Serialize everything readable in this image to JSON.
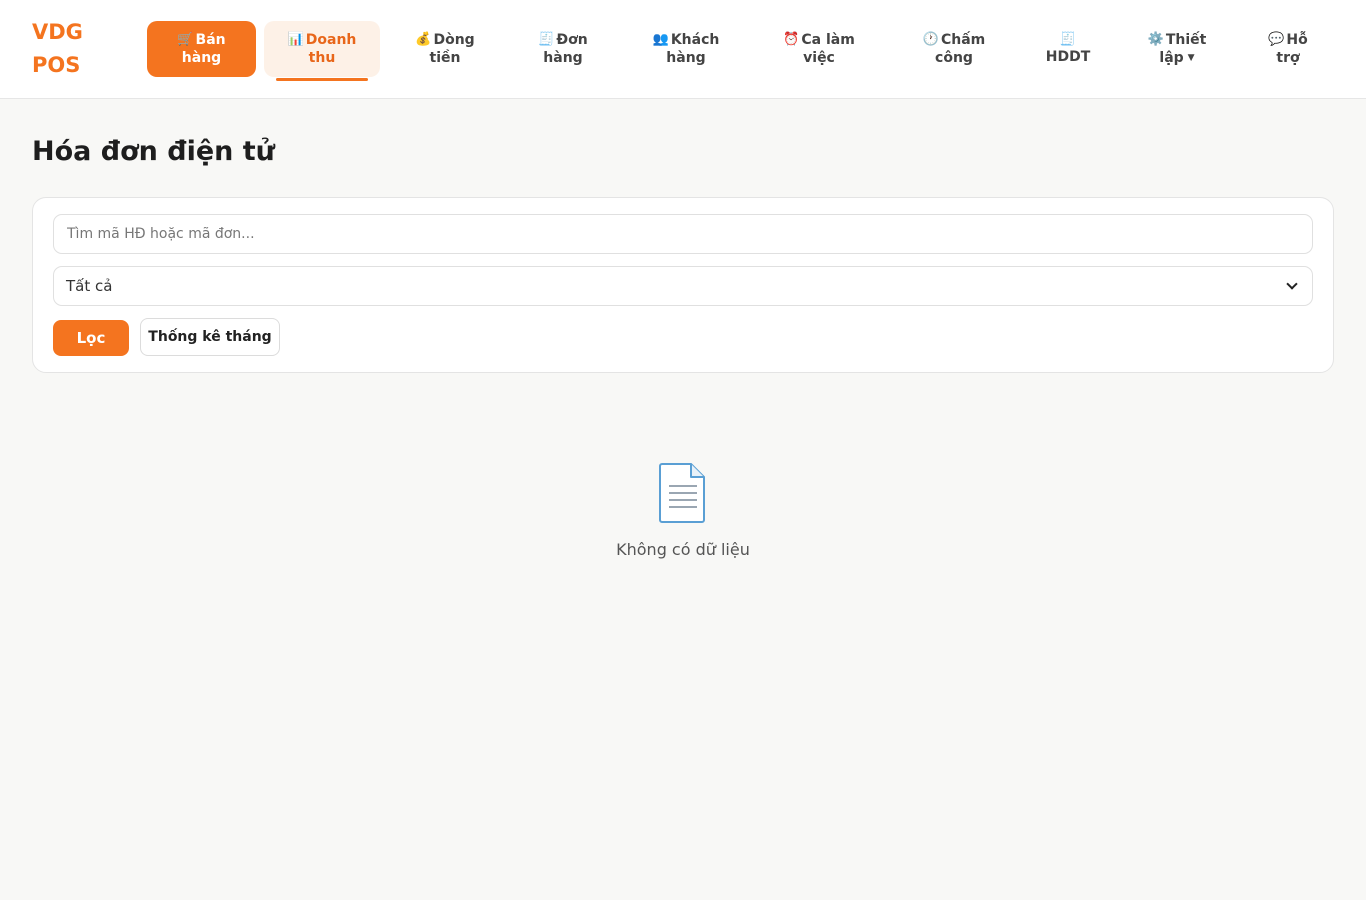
{
  "header": {
    "logo_line1": "VDG",
    "logo_line2": "POS",
    "nav": [
      {
        "icon": "🛒",
        "line1": "Bán",
        "line2": "hàng"
      },
      {
        "icon": "📊",
        "line1": "Doanh",
        "line2": "thu"
      },
      {
        "icon": "💰",
        "line1": "Dòng",
        "line2": "tiền"
      },
      {
        "icon": "🧾",
        "line1": "Đơn",
        "line2": "hàng"
      },
      {
        "icon": "👥",
        "line1": "Khách",
        "line2": "hàng"
      },
      {
        "icon": "⏰",
        "line1": "Ca làm",
        "line2": "việc"
      },
      {
        "icon": "🕐",
        "line1": "Chấm",
        "line2": "công"
      },
      {
        "icon": "🧾",
        "line1": "",
        "line2": "HDDT"
      },
      {
        "icon": "⚙️",
        "line1": "Thiết",
        "line2": "lập"
      },
      {
        "icon": "💬",
        "line1": "Hỗ",
        "line2": "trợ"
      }
    ],
    "primary_color": "#f4741f"
  },
  "page": {
    "title": "Hóa đơn điện tử"
  },
  "filters": {
    "search_placeholder": "Tìm mã HĐ hoặc mã đơn...",
    "status_selected": "Tất cả",
    "filter_label": "Lọc",
    "stats_label": "Thống kê tháng"
  },
  "empty_state": {
    "icon": "document-icon",
    "message": "Không có dữ liệu"
  }
}
